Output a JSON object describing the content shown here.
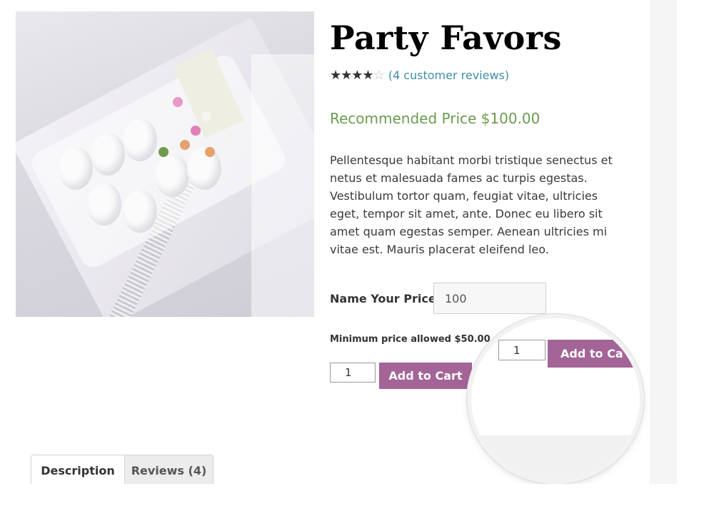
{
  "product": {
    "title": "Party Favors",
    "rating": {
      "stars_filled": 4,
      "stars_total": 5,
      "reviews_link": "(4 customer reviews)"
    },
    "recommended_price": "Recommended Price $100.00",
    "description": "Pellentesque habitant morbi tristique senectus et netus et malesuada fames ac turpis egestas. Vestibulum tortor quam, feugiat vitae, ultricies eget, tempor sit amet, ante. Donec eu libero sit amet quam egestas semper. Aenean ultricies mi vitae est. Mauris placerat eleifend leo."
  },
  "name_your_price": {
    "label": "Name Your Price",
    "value": "100",
    "minimum_note": "Minimum price allowed $50.00"
  },
  "cart": {
    "quantity": "1",
    "add_to_cart_label": "Add to Cart"
  },
  "magnifier": {
    "quantity": "1",
    "add_to_cart_label": "Add to Ca"
  },
  "tabs": [
    {
      "label": "Description",
      "active": true
    },
    {
      "label": "Reviews (4)",
      "active": false
    }
  ],
  "colors": {
    "accent_button": "#a46497",
    "recommended_price": "#6b9b50",
    "link": "#3f8fa6"
  },
  "icons": [
    "star-filled-icon",
    "star-empty-icon"
  ]
}
